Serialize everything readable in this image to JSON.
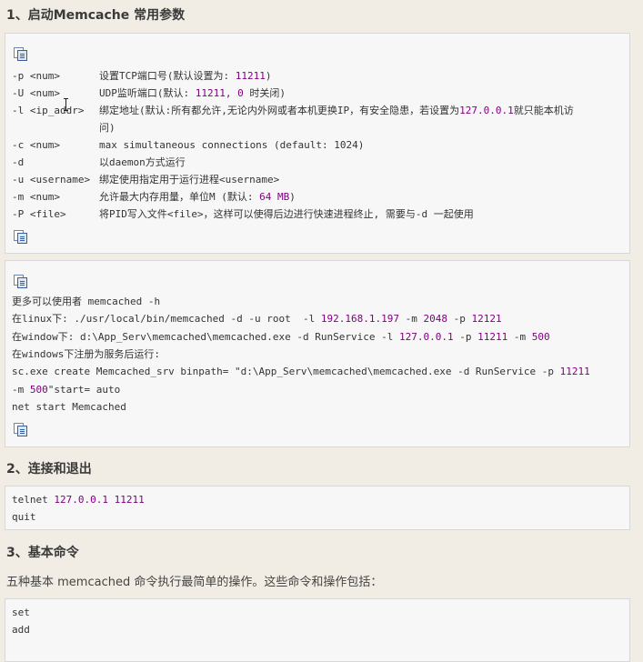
{
  "section1": {
    "title": "1、启动Memcache 常用参数",
    "params": [
      {
        "flag": "-p <num>",
        "desc_pre": "设置TCP端口号(默认设置为: ",
        "num": "11211",
        "desc_post": ")"
      },
      {
        "flag": "-U <num>",
        "desc_pre": "UDP监听端口(默认: ",
        "num": "11211, 0",
        "desc_post": " 时关闭)"
      },
      {
        "flag": "-l <ip_addr>",
        "desc_pre": "绑定地址(默认:所有都允许,无论内外网或者本机更换IP，有安全隐患，若设置为",
        "num": "127.0.0.1",
        "desc_post": "就只能本机访"
      },
      {
        "flag": "",
        "desc_pre": "问)",
        "num": "",
        "desc_post": ""
      },
      {
        "flag": "-c <num>",
        "desc_pre": "max simultaneous connections (default: 1024)",
        "num": "",
        "desc_post": ""
      },
      {
        "flag": "-d",
        "desc_pre": "以daemon方式运行",
        "num": "",
        "desc_post": ""
      },
      {
        "flag": "-u <username>",
        "desc_pre": "绑定使用指定用于运行进程<username>",
        "num": "",
        "desc_post": ""
      },
      {
        "flag": "-m <num>",
        "desc_pre": "允许最大内存用量，单位M (默认: ",
        "num": "64 MB",
        "desc_post": ")"
      },
      {
        "flag": "-P <file>",
        "desc_pre": "将PID写入文件<file>，这样可以使得后边进行快速进程终止, 需要与-d 一起使用",
        "num": "",
        "desc_post": ""
      }
    ]
  },
  "usage_box": {
    "lines": [
      {
        "pre": "更多可以使用者 memcached -h",
        "num": "",
        "post": "",
        "num2": "",
        "post2": "",
        "num3": "",
        "post3": ""
      },
      {
        "pre": "在linux下: ./usr/local/bin/memcached -d -u root  -l ",
        "num": "192.168.1.197",
        "post": " -m ",
        "num2": "2048",
        "post2": " -p ",
        "num3": "12121",
        "post3": ""
      },
      {
        "pre": "在window下: d:\\App_Serv\\memcached\\memcached.exe -d RunService -l ",
        "num": "127.0.0.1",
        "post": " -p ",
        "num2": "11211",
        "post2": " -m ",
        "num3": "500",
        "post3": ""
      },
      {
        "pre": "在windows下注册为服务后运行:",
        "num": "",
        "post": "",
        "num2": "",
        "post2": "",
        "num3": "",
        "post3": ""
      },
      {
        "pre": "sc.exe create Memcached_srv binpath= \"d:\\App_Serv\\memcached\\memcached.exe -d RunService -p ",
        "num": "11211",
        "post": "",
        "num2": "",
        "post2": "",
        "num3": "",
        "post3": ""
      },
      {
        "pre": "-m ",
        "num": "500",
        "post": "\"start= auto",
        "num2": "",
        "post2": "",
        "num3": "",
        "post3": ""
      },
      {
        "pre": "net start Memcached",
        "num": "",
        "post": "",
        "num2": "",
        "post2": "",
        "num3": "",
        "post3": ""
      }
    ]
  },
  "section2": {
    "title": "2、连接和退出",
    "lines": [
      {
        "pre": "telnet ",
        "num": "127.0.0.1 11211"
      },
      {
        "pre": "quit",
        "num": ""
      }
    ]
  },
  "section3": {
    "title": "3、基本命令",
    "intro": "五种基本 memcached 命令执行最简单的操作。这些命令和操作包括：",
    "commands": [
      "set",
      "add"
    ]
  },
  "colors": {
    "number": "#800080",
    "background": "#f1ede4",
    "codebox_bg": "#f7f7f7",
    "codebox_border": "#d8d8d8"
  },
  "icons": [
    "copy-icon"
  ]
}
